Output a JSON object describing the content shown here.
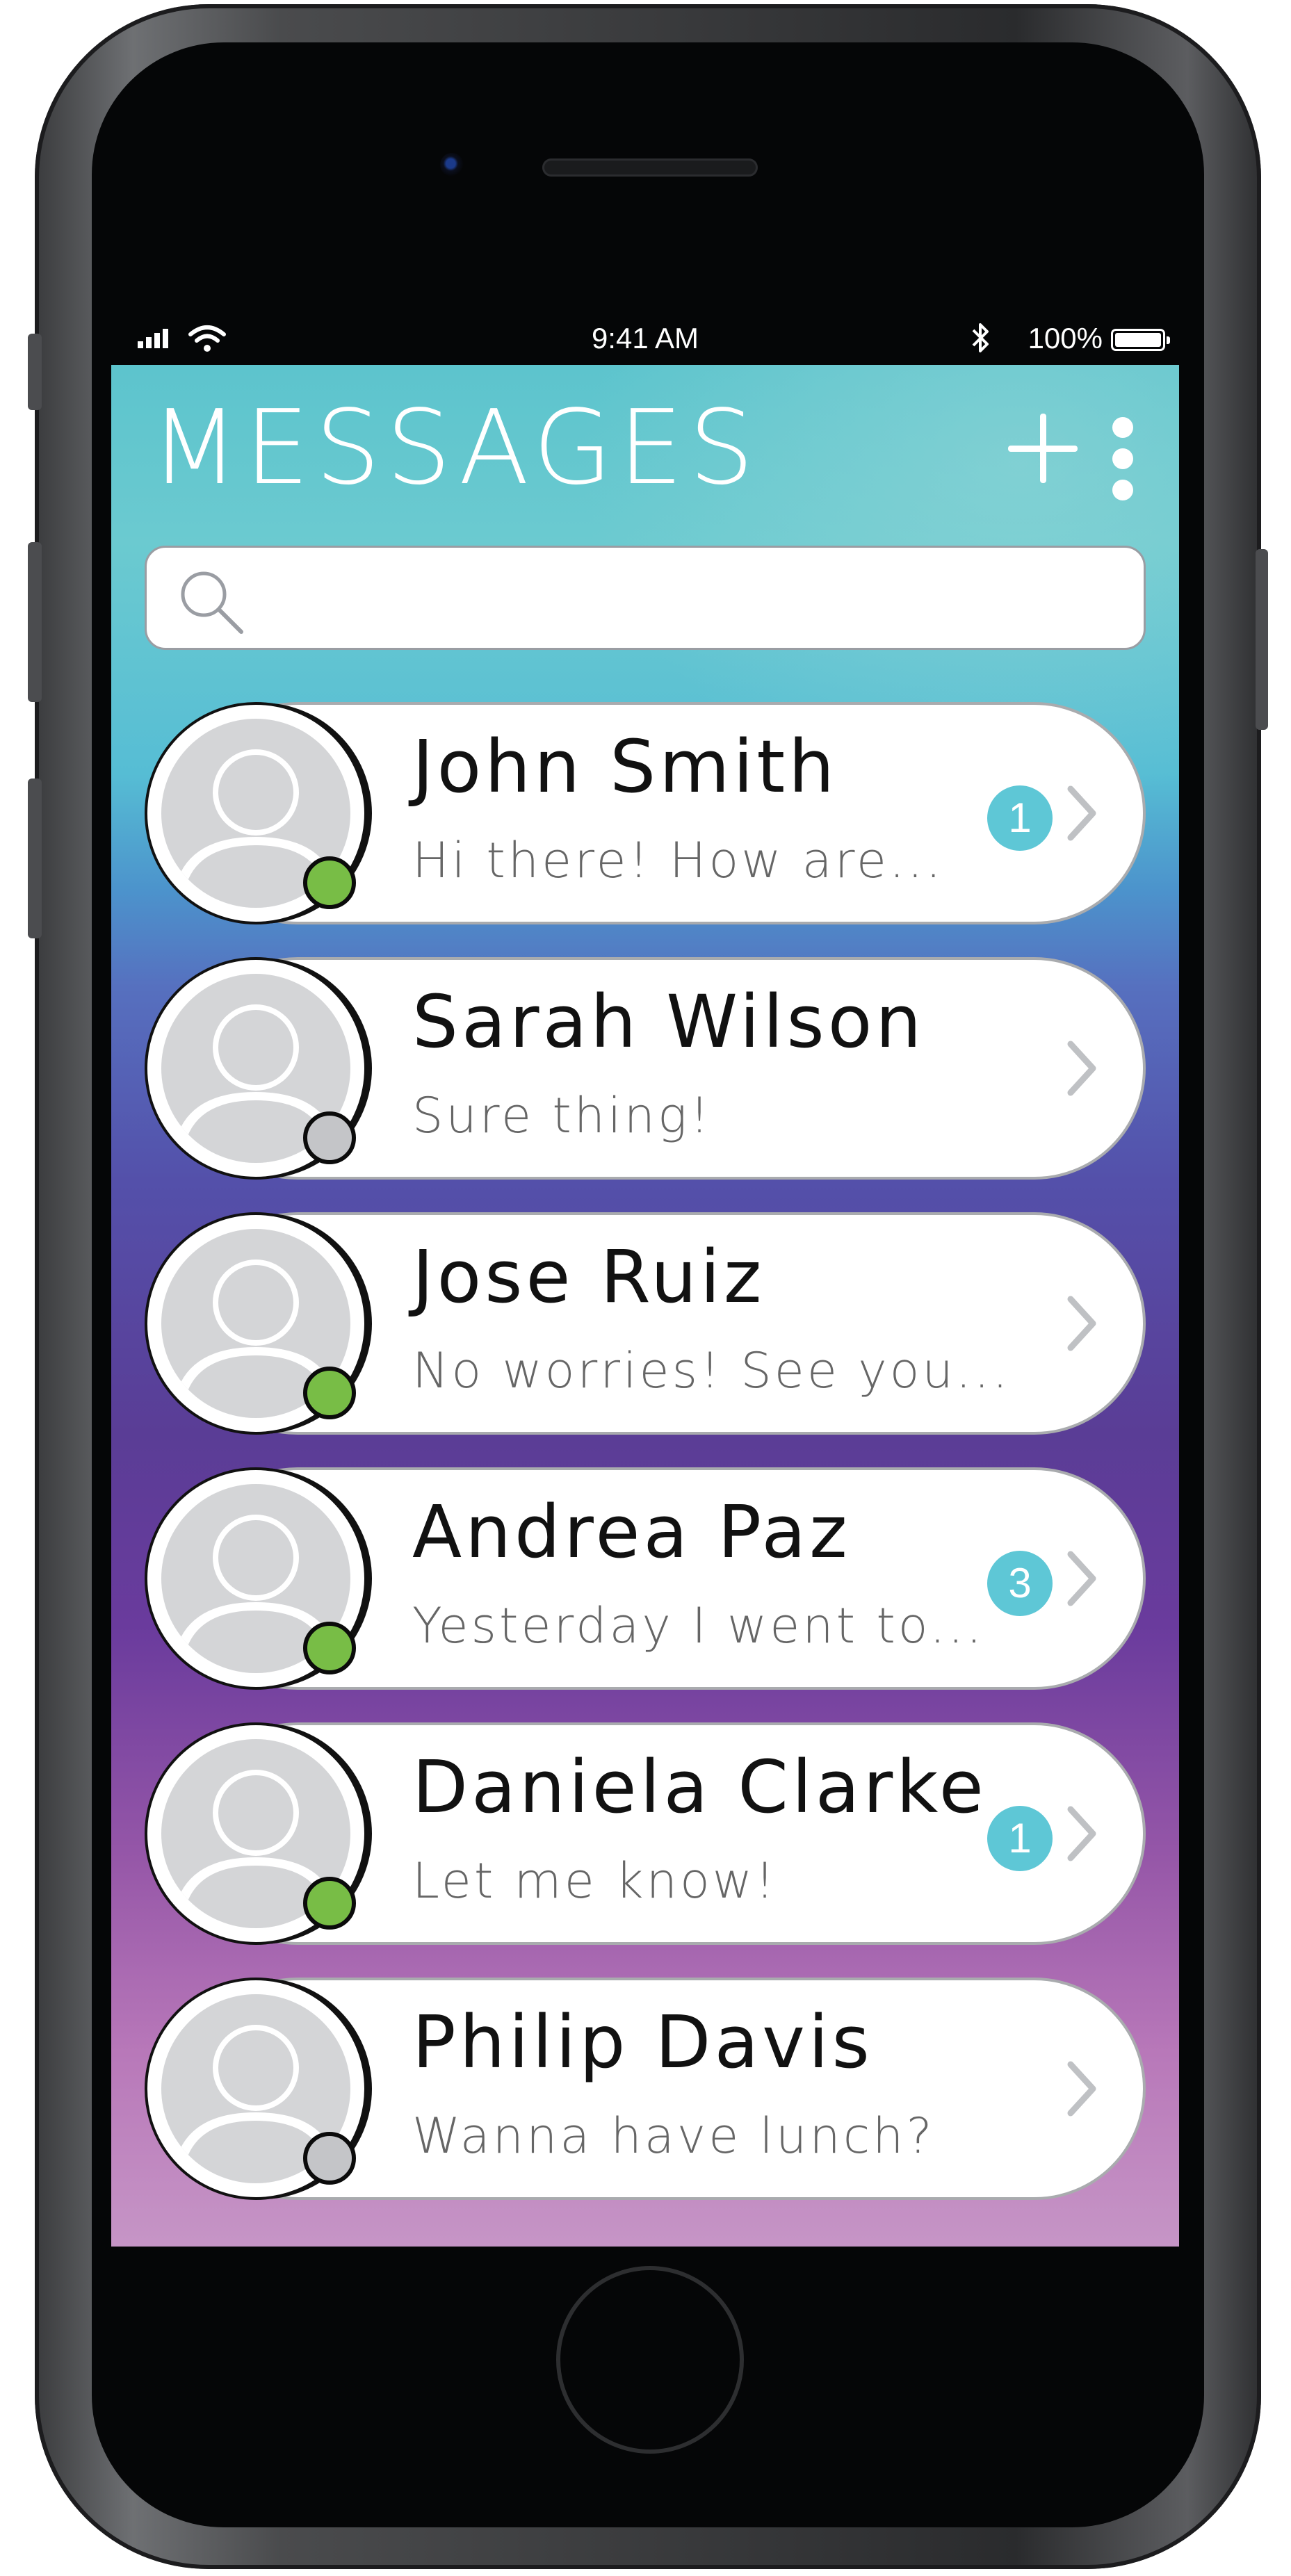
{
  "status_bar": {
    "time": "9:41 AM",
    "battery": "100%"
  },
  "header": {
    "title": "MESSAGES",
    "add_icon": "plus-icon",
    "menu_icon": "more-vertical-icon"
  },
  "search": {
    "placeholder": "",
    "value": "",
    "icon": "search-icon"
  },
  "colors": {
    "online": "#78bd46",
    "offline": "#c4c5c8",
    "badge": "#5ec7d6"
  },
  "conversations": [
    {
      "name": "John Smith",
      "preview": "Hi there! How are...",
      "status": "online",
      "unread": "1"
    },
    {
      "name": "Sarah Wilson",
      "preview": "Sure thing!",
      "status": "offline",
      "unread": ""
    },
    {
      "name": "Jose Ruiz",
      "preview": "No worries! See you...",
      "status": "online",
      "unread": ""
    },
    {
      "name": "Andrea Paz",
      "preview": "Yesterday I went to...",
      "status": "online",
      "unread": "3"
    },
    {
      "name": "Daniela Clarke",
      "preview": "Let me know!",
      "status": "online",
      "unread": "1"
    },
    {
      "name": "Philip Davis",
      "preview": "Wanna have lunch?",
      "status": "offline",
      "unread": ""
    }
  ]
}
